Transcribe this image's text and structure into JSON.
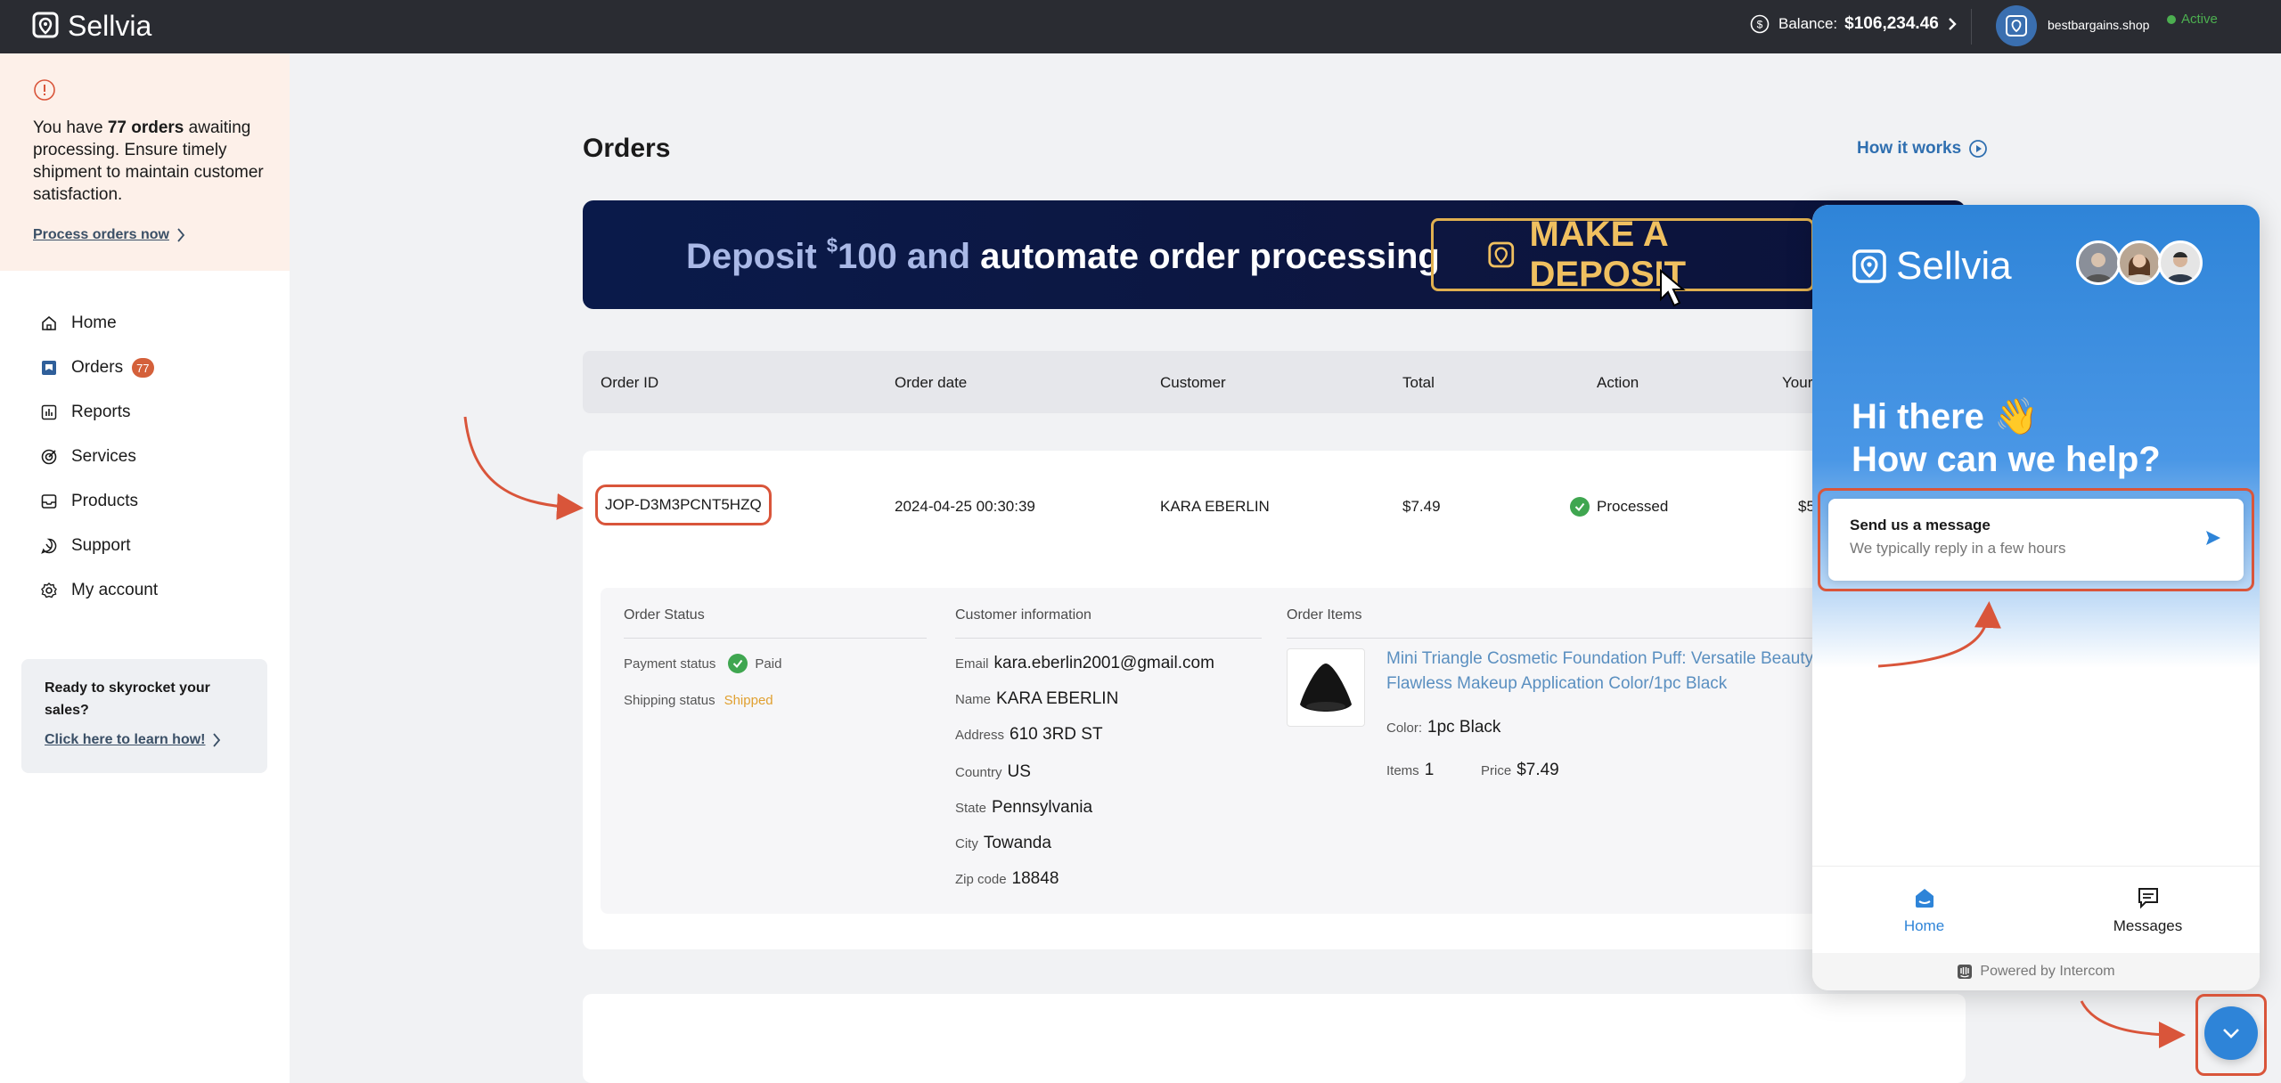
{
  "topbar": {
    "brand": "Sellvia",
    "balance_label": "Balance:",
    "balance_amount": "$106,234.46",
    "account_name": "bestbargains.shop",
    "account_status": "Active"
  },
  "sidebar": {
    "alert": {
      "prefix": "You have ",
      "count": "77 orders",
      "suffix": " awaiting processing. Ensure timely shipment to maintain customer satisfaction.",
      "link": "Process orders now"
    },
    "nav": [
      {
        "label": "Home",
        "icon": "home-icon"
      },
      {
        "label": "Orders",
        "icon": "orders-icon",
        "badge": "77"
      },
      {
        "label": "Reports",
        "icon": "reports-icon"
      },
      {
        "label": "Services",
        "icon": "services-icon"
      },
      {
        "label": "Products",
        "icon": "products-icon"
      },
      {
        "label": "Support",
        "icon": "support-icon"
      },
      {
        "label": "My account",
        "icon": "account-icon"
      }
    ],
    "promo": {
      "text": "Ready to skyrocket your sales?",
      "link": "Click here to learn how!"
    }
  },
  "main": {
    "title": "Orders",
    "how_it_works": "How it works",
    "banner": {
      "word1": "Deposit ",
      "currency": "$",
      "amount": "100",
      "word2": " and ",
      "word3": "automate order processing",
      "button": "MAKE A DEPOSIT"
    },
    "table": {
      "headers": [
        "Order ID",
        "Order date",
        "Customer",
        "Total",
        "Action",
        "Your"
      ]
    },
    "order": {
      "id": "JOP-D3M3PCNT5HZQ",
      "date": "2024-04-25 00:30:39",
      "customer": "KARA EBERLIN",
      "total": "$7.49",
      "action": "Processed",
      "your_partial": "$5",
      "status": {
        "title": "Order Status",
        "payment_label": "Payment status",
        "payment_value": "Paid",
        "shipping_label": "Shipping status",
        "shipping_value": "Shipped"
      },
      "customer_info": {
        "title": "Customer information",
        "email_label": "Email",
        "email": "kara.eberlin2001@gmail.com",
        "name_label": "Name",
        "name": "KARA EBERLIN",
        "address_label": "Address",
        "address": "610 3RD ST",
        "country_label": "Country",
        "country": "US",
        "state_label": "State",
        "state": "Pennsylvania",
        "city_label": "City",
        "city": "Towanda",
        "zip_label": "Zip code",
        "zip": "18848"
      },
      "items": {
        "title": "Order Items",
        "product_title": "Mini Triangle Cosmetic Foundation Puff: Versatile Beauty Flawless Makeup Application Color/1pc Black",
        "color_label": "Color:",
        "color": "1pc Black",
        "items_label": "Items",
        "items": "1",
        "price_label": "Price",
        "price": "$7.49"
      }
    }
  },
  "widget": {
    "brand": "Sellvia",
    "greeting_line1": "Hi there 👋",
    "greeting_line2": "How can we help?",
    "card_title": "Send us a message",
    "card_sub": "We typically reply in a few hours",
    "tab_home": "Home",
    "tab_messages": "Messages",
    "footer": "Powered by Intercom"
  },
  "colors": {
    "topbar": "#2a2c32",
    "accent_blue": "#2e84d8",
    "annotation_red": "#d9553a",
    "banner_gold": "#f0c060"
  }
}
